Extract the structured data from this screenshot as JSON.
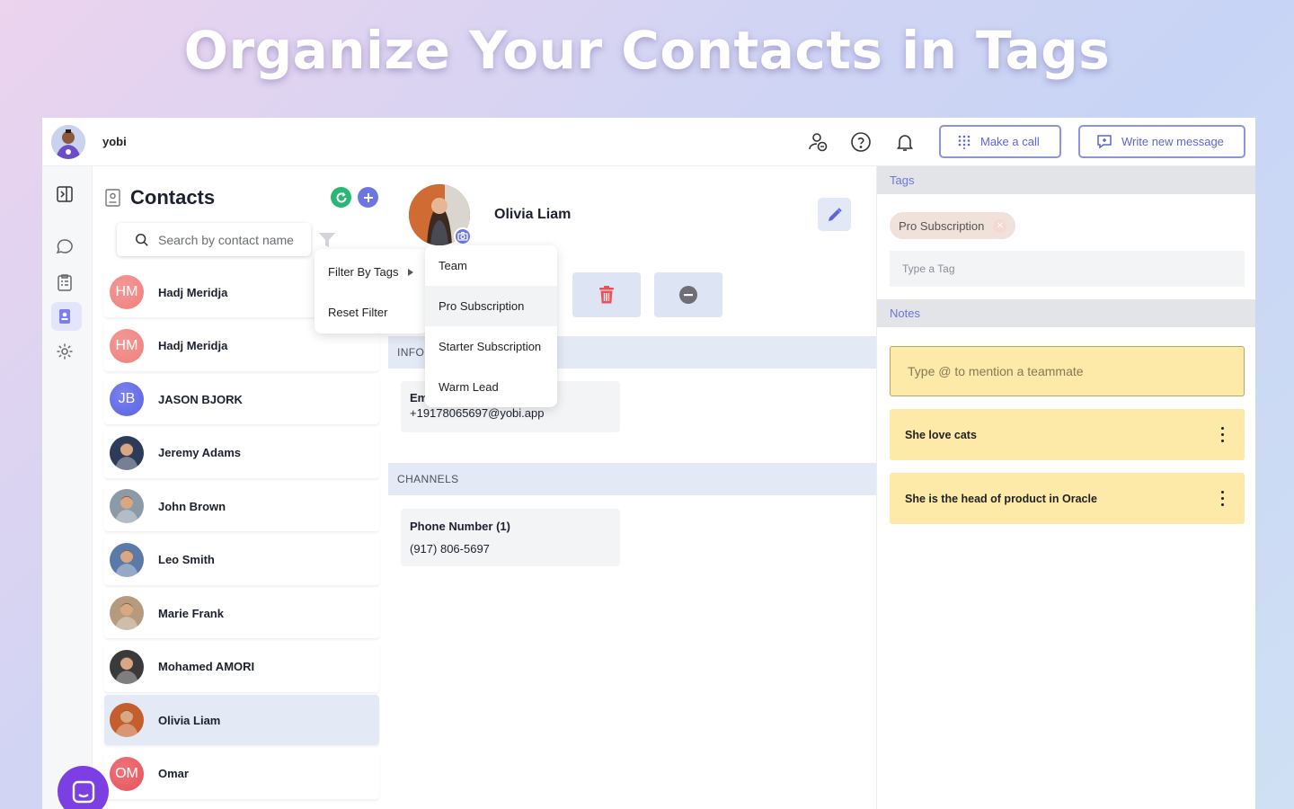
{
  "hero": {
    "title": "Organize Your Contacts in Tags"
  },
  "topbar": {
    "brand": "yobi",
    "make_call": "Make a call",
    "write_message": "Write new message"
  },
  "contacts": {
    "title": "Contacts",
    "search_placeholder": "Search by contact name",
    "items": [
      {
        "initials": "HM",
        "name": "Hadj Meridja",
        "color": "#f07f7c"
      },
      {
        "initials": "HM",
        "name": "Hadj Meridja",
        "color": "#f07f7c"
      },
      {
        "initials": "JB",
        "name": "JASON BJORK",
        "color": "#5a63e6"
      },
      {
        "initials": "",
        "name": "Jeremy Adams",
        "color": "#2d3b5a"
      },
      {
        "initials": "",
        "name": "John Brown",
        "color": "#8c9aa8"
      },
      {
        "initials": "",
        "name": "Leo Smith",
        "color": "#5c7aa8"
      },
      {
        "initials": "",
        "name": "Marie Frank",
        "color": "#b59a7d"
      },
      {
        "initials": "",
        "name": "Mohamed AMORI",
        "color": "#3a3a3a"
      },
      {
        "initials": "",
        "name": "Olivia Liam",
        "color": "#c45e2d"
      },
      {
        "initials": "OM",
        "name": "Omar",
        "color": "#e8525a"
      }
    ]
  },
  "filter_menu": {
    "filter_by_tags": "Filter By Tags",
    "reset_filter": "Reset Filter",
    "tags": [
      "Team",
      "Pro Subscription",
      "Starter Subscription",
      "Warm Lead"
    ]
  },
  "detail": {
    "name": "Olivia Liam",
    "info_section": "INFOR",
    "email_label": "Em",
    "email_value": "+19178065697@yobi.app",
    "channels_section": "CHANNELS",
    "phone_label": "Phone Number (1)",
    "phone_value": "(917) 806-5697"
  },
  "right": {
    "tags_header": "Tags",
    "tag_chip": "Pro Subscription",
    "tag_placeholder": "Type a Tag",
    "notes_header": "Notes",
    "note_placeholder": "Type @ to mention a teammate",
    "notes": [
      "She love cats",
      "She is the head of product in Oracle"
    ]
  },
  "colors": {
    "accent": "#6b76e0",
    "refresh": "#2bb673",
    "add": "#6b76e0",
    "delete": "#e8525a",
    "note_bg": "#fdeaa8"
  }
}
